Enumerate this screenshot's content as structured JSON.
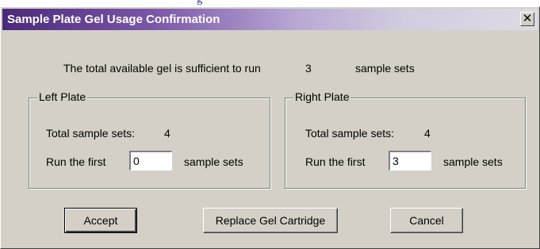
{
  "background_text": "g",
  "dialog": {
    "title": "Sample Plate Gel Usage Confirmation",
    "close_glyph": "✕",
    "message_prefix": "The total available gel is sufficient to run",
    "message_count": "3",
    "message_suffix": "sample sets"
  },
  "left_plate": {
    "legend": "Left Plate",
    "total_label": "Total sample sets:",
    "total_value": "4",
    "run_label": "Run the first",
    "run_value": "0",
    "run_suffix": "sample sets"
  },
  "right_plate": {
    "legend": "Right Plate",
    "total_label": "Total sample sets:",
    "total_value": "4",
    "run_label": "Run the first",
    "run_value": "3",
    "run_suffix": "sample sets"
  },
  "buttons": {
    "accept": "Accept",
    "replace": "Replace Gel Cartridge",
    "cancel": "Cancel"
  },
  "colors": {
    "title_bar_start": "#4b2a7a",
    "dialog_face": "#d4d0c8"
  }
}
